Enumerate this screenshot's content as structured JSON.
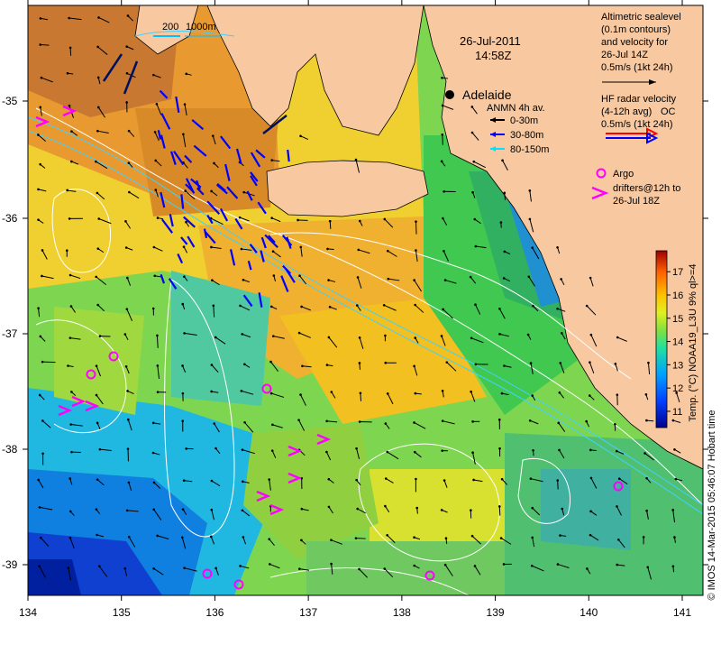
{
  "header": {
    "date": "26-Jul-2011",
    "time": "14:58Z"
  },
  "scale_bar": {
    "label_a": "200",
    "label_b": "1000m"
  },
  "city": {
    "name": "Adelaide"
  },
  "altimetry_legend": {
    "lines": [
      "Altimetric sealevel",
      "(0.1m contours)",
      "and velocity for",
      "26-Jul 14Z",
      "0.5m/s (1kt 24h)"
    ]
  },
  "hf_radar_legend": {
    "lines": [
      "HF radar velocity",
      "(4-12h avg) ",
      "0.5m/s (1kt 24h)"
    ],
    "suffix": "OC"
  },
  "anmn_legend": {
    "title": "ANMN 4h av.",
    "items": [
      {
        "label": "0-30m",
        "color": "#000000"
      },
      {
        "label": "30-80m",
        "color": "#0000ff"
      },
      {
        "label": "80-150m",
        "color": "#00e0ff"
      }
    ]
  },
  "argo_legend": {
    "lines": [
      "Argo",
      "drifters@12h to",
      "26-Jul 18Z"
    ],
    "color": "#ff00ff"
  },
  "colorbar": {
    "label": "Temp. (°C) NOAA19_L3U 9% ql>=4",
    "ticks": [
      "17",
      "16",
      "15",
      "14",
      "13",
      "12",
      "11"
    ],
    "range": [
      10.3,
      17.9
    ]
  },
  "credit": {
    "text": "© IMOS 14-Mar-2015 05:46:07 Hobart time"
  },
  "axes": {
    "x_ticks": [
      "134",
      "135",
      "136",
      "137",
      "138",
      "139",
      "140",
      "141"
    ],
    "y_ticks": [
      "-35",
      "-36",
      "-37",
      "-38",
      "-39"
    ]
  },
  "colors": {
    "land": "#f8c8a0",
    "argo": "#ff00ff",
    "hf_red": "#ff0000",
    "hf_blue": "#0000ff"
  }
}
